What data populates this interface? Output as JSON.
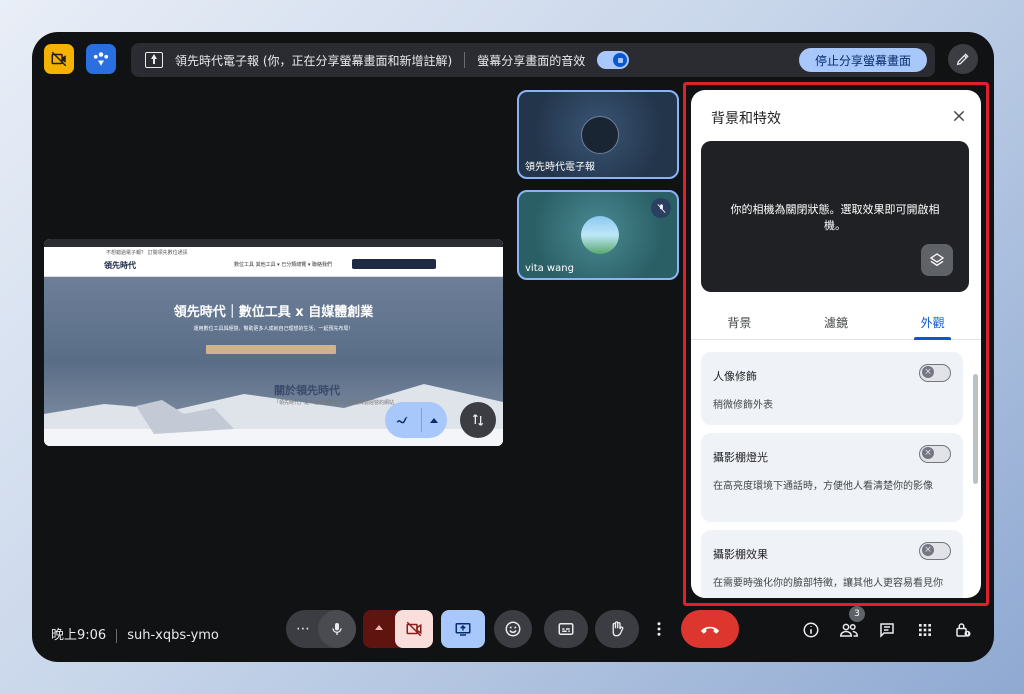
{
  "topbar": {
    "banner_text": "領先時代電子報 (你，正在分享螢幕畫面和新增註解)",
    "audio_label": "螢幕分享畫面的音效",
    "stop_share_label": "停止分享螢幕畫面",
    "icons": [
      "camera-off-icon",
      "host-controls-icon",
      "present-icon",
      "pen-icon"
    ]
  },
  "shared_screen": {
    "top_link": "不想錯過電子報？ 訂閱領先數位通訊",
    "logo": "領先時代",
    "menu": "數位工具    其他工具 ▾    已分類總覽 ▾    聯絡我們",
    "hero_title": "領先時代｜數位工具 x 自媒體創業",
    "hero_sub": "運用數位工具與經營，幫助更多人成就自己理想的生活，一起預先布局！",
    "about_title": "關於領先時代",
    "about_sub": "「領先時代」是一個分享數位工具與自媒體經營的網站"
  },
  "participants": [
    {
      "name": "領先時代電子報",
      "muted": false
    },
    {
      "name": "vita wang",
      "muted": true
    }
  ],
  "panel": {
    "title": "背景和特效",
    "preview_message": "你的相機為關閉狀態。選取效果即可開啟相機。",
    "tabs": [
      {
        "label": "背景",
        "active": false
      },
      {
        "label": "濾鏡",
        "active": false
      },
      {
        "label": "外觀",
        "active": true
      }
    ],
    "cards": [
      {
        "title": "人像修飾",
        "desc": "稍微修飾外表",
        "enabled": false
      },
      {
        "title": "攝影棚燈光",
        "desc": "在高亮度環境下通話時，方便他人看清楚你的影像",
        "enabled": false
      },
      {
        "title": "攝影棚效果",
        "desc": "在需要時強化你的臉部特徵，讓其他人更容易看見你",
        "enabled": false
      }
    ]
  },
  "bottombar": {
    "time": "晚上9:06",
    "meeting_code": "suh-xqbs-ymo",
    "people_count": "3",
    "colors": {
      "end_call": "#dc362e",
      "present_active": "#a8c7fa",
      "camera_off": "#f9dedc"
    }
  }
}
